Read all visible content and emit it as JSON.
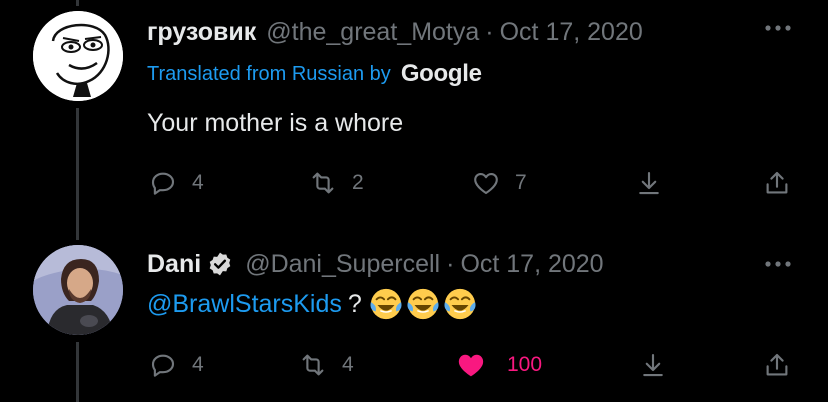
{
  "tweets": [
    {
      "name": "грузовик",
      "handle": "@the_great_Motya",
      "separator": "·",
      "date": "Oct 17, 2020",
      "translated_label": "Translated from Russian by",
      "translated_brand": "Google",
      "text": "Your mother is a whore",
      "replies": "4",
      "retweets": "2",
      "likes": "7",
      "liked": false
    },
    {
      "name": "Dani",
      "verified": true,
      "handle": "@Dani_Supercell",
      "separator": "·",
      "date": "Oct 17, 2020",
      "mention": "@BrawlStarsKids",
      "text_suffix": "?",
      "emoji": [
        "face-with-tears-of-joy",
        "face-with-tears-of-joy",
        "face-with-tears-of-joy"
      ],
      "replies": "4",
      "retweets": "4",
      "likes": "100",
      "liked": true
    }
  ],
  "colors": {
    "background": "#000000",
    "text": "#e7e9ea",
    "muted": "#71767b",
    "link": "#1d9bf0",
    "like_active": "#f91880",
    "thread_line": "#333639"
  }
}
